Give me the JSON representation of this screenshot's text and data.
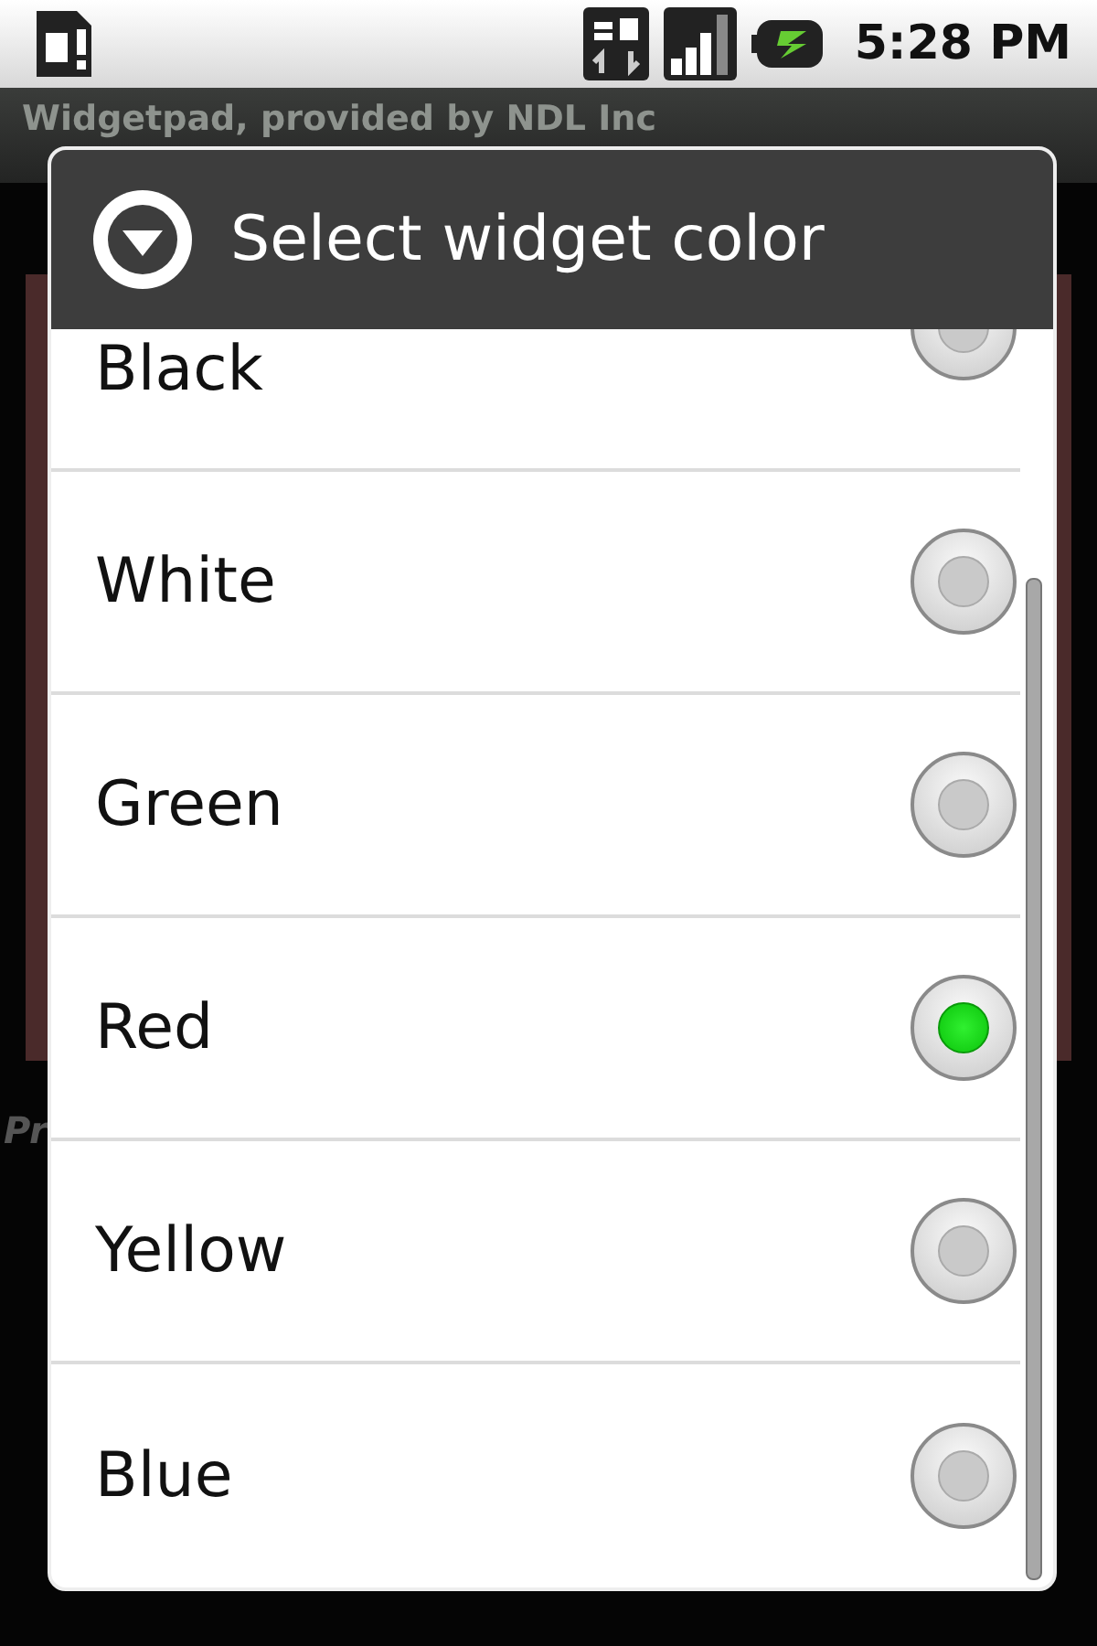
{
  "status_bar": {
    "time": "5:28 PM"
  },
  "app": {
    "title": "Widgetpad, provided by NDL Inc",
    "body_text": "Pr"
  },
  "dialog": {
    "title": "Select widget color",
    "options": [
      {
        "label": "Black",
        "selected": false
      },
      {
        "label": "White",
        "selected": false
      },
      {
        "label": "Green",
        "selected": false
      },
      {
        "label": "Red",
        "selected": true
      },
      {
        "label": "Yellow",
        "selected": false
      },
      {
        "label": "Blue",
        "selected": false
      }
    ]
  }
}
